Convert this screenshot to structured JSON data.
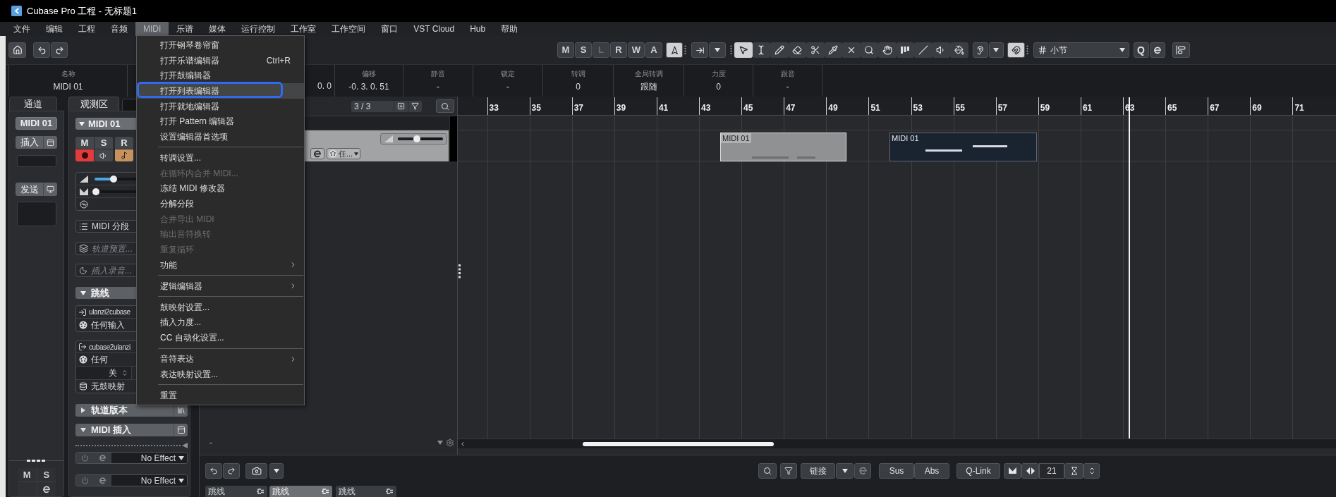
{
  "window": {
    "title": "Cubase Pro 工程 - 无标题1"
  },
  "menu_bar": [
    {
      "label": "文件",
      "selected": false
    },
    {
      "label": "编辑",
      "selected": false
    },
    {
      "label": "工程",
      "selected": false
    },
    {
      "label": "音频",
      "selected": false
    },
    {
      "label": "MIDI",
      "selected": true
    },
    {
      "label": "乐谱",
      "selected": false
    },
    {
      "label": "媒体",
      "selected": false
    },
    {
      "label": "运行控制",
      "selected": false
    },
    {
      "label": "工作室",
      "selected": false
    },
    {
      "label": "工作空间",
      "selected": false
    },
    {
      "label": "窗口",
      "selected": false
    },
    {
      "label": "VST Cloud",
      "selected": false
    },
    {
      "label": "Hub",
      "selected": false
    },
    {
      "label": "帮助",
      "selected": false
    }
  ],
  "toolbar": {
    "state_buttons": [
      {
        "label": "M",
        "disabled": false
      },
      {
        "label": "S",
        "disabled": false
      },
      {
        "label": "L",
        "disabled": true
      },
      {
        "label": "R",
        "disabled": false
      },
      {
        "label": "W",
        "disabled": false
      },
      {
        "label": "A",
        "disabled": false
      }
    ],
    "autoscroll_on": true,
    "tools": [
      {
        "kind": "select",
        "selected": true
      },
      {
        "kind": "range",
        "selected": false
      },
      {
        "kind": "draw",
        "selected": false
      },
      {
        "kind": "erase",
        "selected": false
      },
      {
        "kind": "split",
        "selected": false
      },
      {
        "kind": "glue",
        "selected": false
      },
      {
        "kind": "mute",
        "selected": false
      },
      {
        "kind": "zoom",
        "selected": false
      },
      {
        "kind": "hand",
        "selected": false
      },
      {
        "kind": "comp",
        "selected": false
      },
      {
        "kind": "line",
        "selected": false
      },
      {
        "kind": "play",
        "selected": false
      },
      {
        "kind": "color",
        "selected": false
      }
    ],
    "snap_on": true,
    "grid_type": "小节",
    "quantize": "Q"
  },
  "info_line": [
    {
      "kind": "field",
      "label": "名称",
      "value": "MIDI 01"
    },
    {
      "kind": "covered",
      "value": "0. 0"
    },
    {
      "kind": "field",
      "label": "偏移",
      "value": "-0. 3. 0. 51"
    },
    {
      "kind": "field",
      "label": "静音",
      "value": "-"
    },
    {
      "kind": "field",
      "label": "锁定",
      "value": "-"
    },
    {
      "kind": "field",
      "label": "转调",
      "value": "0"
    },
    {
      "kind": "field",
      "label": "全局转调",
      "value": "跟随"
    },
    {
      "kind": "field",
      "label": "力度",
      "value": "0"
    },
    {
      "kind": "field",
      "label": "跟音",
      "value": "-"
    }
  ],
  "left_zone": {
    "tab": "通道",
    "channel": "MIDI 01",
    "insert": "插入",
    "send": "发送",
    "footer_buttons": [
      "M",
      "S"
    ]
  },
  "inspector": {
    "tabs": [
      {
        "label": "观测区",
        "selected": true
      },
      {
        "selected": false
      }
    ],
    "track": {
      "name": "MIDI 01",
      "expanded": true
    },
    "track_buttons": [
      "M",
      "S",
      "R"
    ],
    "record_enabled": true,
    "musical_timebase": true,
    "volume": {
      "level": 0.22
    },
    "pan": {
      "level": 0.02
    },
    "segment": "MIDI 分段",
    "preset": {
      "placeholder": "轨道预置..."
    },
    "record_insert": {
      "placeholder": "插入录音..."
    },
    "routing": {
      "title": "跳线",
      "expanded": true,
      "input_port": "ulanzi2cubase",
      "input_channel": "任何输入",
      "output_port": "cubase2ulanzi",
      "output_channel": "任何",
      "program": "关",
      "drum_map": "无鼓映射"
    },
    "sections": [
      {
        "title": "轨道版本",
        "expanded": false
      },
      {
        "title": "MIDI 插入",
        "expanded": true
      }
    ],
    "insert_slots": [
      {
        "effect": "No Effect"
      },
      {
        "effect": "No Effect"
      }
    ]
  },
  "track_list": {
    "counter": "3 / 3",
    "track": {
      "volume": {
        "level": 0.42
      },
      "input": "任..."
    },
    "footer": "-"
  },
  "arrange": {
    "ruler": [
      {
        "label": "33",
        "cursor": false
      },
      {
        "label": "35",
        "cursor": false
      },
      {
        "label": "37",
        "cursor": false
      },
      {
        "label": "39",
        "cursor": false
      },
      {
        "label": "41",
        "cursor": false
      },
      {
        "label": "43",
        "cursor": false
      },
      {
        "label": "45",
        "cursor": false
      },
      {
        "label": "47",
        "cursor": false
      },
      {
        "label": "49",
        "cursor": false
      },
      {
        "label": "51",
        "cursor": false
      },
      {
        "label": "53",
        "cursor": false
      },
      {
        "label": "55",
        "cursor": false
      },
      {
        "label": "57",
        "cursor": false
      },
      {
        "label": "59",
        "cursor": false
      },
      {
        "label": "61",
        "cursor": false
      },
      {
        "label": "63",
        "cursor": true
      },
      {
        "label": "65",
        "cursor": false
      },
      {
        "label": "67",
        "cursor": false
      },
      {
        "label": "69",
        "cursor": false
      },
      {
        "label": "71",
        "cursor": false
      }
    ],
    "events": [
      {
        "name": "MIDI 01",
        "selected": true
      },
      {
        "name": "MIDI 01",
        "selected": false
      }
    ]
  },
  "midi_menu": [
    {
      "kind": "item",
      "label": "打开钢琴卷帘窗",
      "selected": false,
      "disabled": false
    },
    {
      "kind": "item",
      "label": "打开乐谱编辑器",
      "shortcut": "Ctrl+R",
      "selected": false,
      "disabled": false
    },
    {
      "kind": "item",
      "label": "打开鼓编辑器",
      "selected": false,
      "disabled": false
    },
    {
      "kind": "item",
      "label": "打开列表编辑器",
      "selected": true,
      "disabled": false
    },
    {
      "kind": "item",
      "label": "打开就地编辑器",
      "selected": false,
      "disabled": false
    },
    {
      "kind": "item",
      "label": "打开 Pattern 编辑器",
      "selected": false,
      "disabled": false
    },
    {
      "kind": "item",
      "label": "设置编辑器首选项",
      "selected": false,
      "disabled": false
    },
    {
      "kind": "separator"
    },
    {
      "kind": "item",
      "label": "转调设置...",
      "selected": false,
      "disabled": false
    },
    {
      "kind": "item",
      "label": "在循环内合并 MIDI...",
      "selected": false,
      "disabled": true
    },
    {
      "kind": "item",
      "label": "冻结 MIDI 修改器",
      "selected": false,
      "disabled": false
    },
    {
      "kind": "item",
      "label": "分解分段",
      "selected": false,
      "disabled": false
    },
    {
      "kind": "item",
      "label": "合并导出 MIDI",
      "selected": false,
      "disabled": true
    },
    {
      "kind": "item",
      "label": "输出音符换转",
      "selected": false,
      "disabled": true
    },
    {
      "kind": "item",
      "label": "重复循环",
      "selected": false,
      "disabled": true
    },
    {
      "kind": "submenu",
      "label": "功能",
      "selected": false,
      "disabled": false
    },
    {
      "kind": "separator"
    },
    {
      "kind": "submenu",
      "label": "逻辑编辑器",
      "selected": false,
      "disabled": false
    },
    {
      "kind": "separator"
    },
    {
      "kind": "item",
      "label": "鼓映射设置...",
      "selected": false,
      "disabled": false
    },
    {
      "kind": "item",
      "label": "插入力度...",
      "selected": false,
      "disabled": false
    },
    {
      "kind": "item",
      "label": "CC 自动化设置...",
      "selected": false,
      "disabled": false
    },
    {
      "kind": "separator"
    },
    {
      "kind": "submenu",
      "label": "音符表达",
      "selected": false,
      "disabled": false
    },
    {
      "kind": "item",
      "label": "表达映射设置...",
      "selected": false,
      "disabled": false
    },
    {
      "kind": "separator"
    },
    {
      "kind": "item",
      "label": "重置",
      "selected": false,
      "disabled": false
    }
  ],
  "lower_zone": {
    "link_mode": "链接",
    "sus": "Sus",
    "abs": "Abs",
    "qlink": "Q-Link",
    "value": "21",
    "tabs": [
      {
        "label": "跳线",
        "selected": false
      },
      {
        "label": "跳线",
        "selected": true
      },
      {
        "label": "跳线",
        "selected": false
      }
    ]
  }
}
